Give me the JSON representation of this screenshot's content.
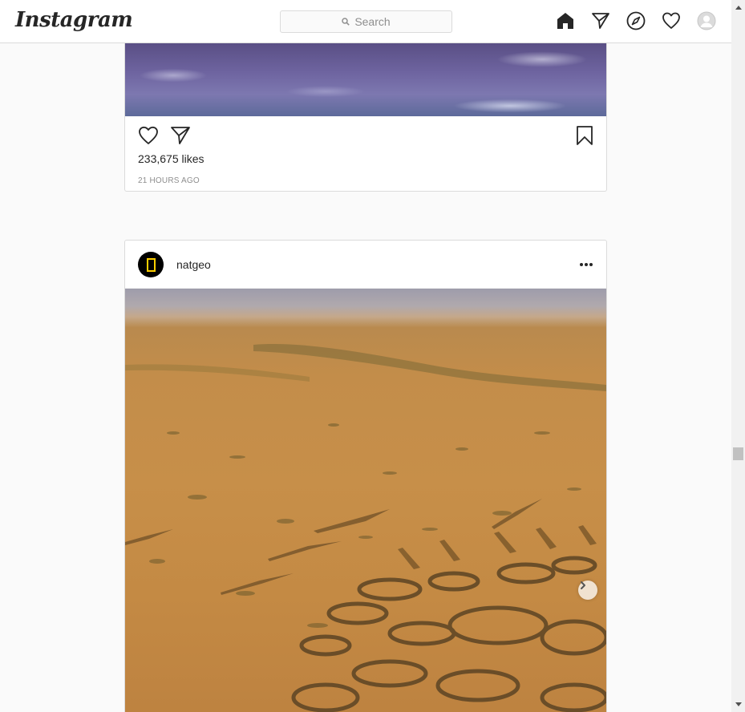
{
  "nav": {
    "logo": "Instagram",
    "search_placeholder": "Search",
    "icons": [
      "home-icon",
      "direct-icon",
      "explore-icon",
      "activity-icon",
      "profile-icon"
    ]
  },
  "post1": {
    "likes": "233,675 likes",
    "time": "21 HOURS AGO"
  },
  "post2": {
    "username": "natgeo",
    "colors": {
      "avatar_bg": "#000000",
      "avatar_frame": "#ffce00"
    }
  },
  "colors": {
    "border": "#dbdbdb",
    "background": "#fafafa",
    "text": "#262626",
    "muted": "#8e8e8e"
  }
}
